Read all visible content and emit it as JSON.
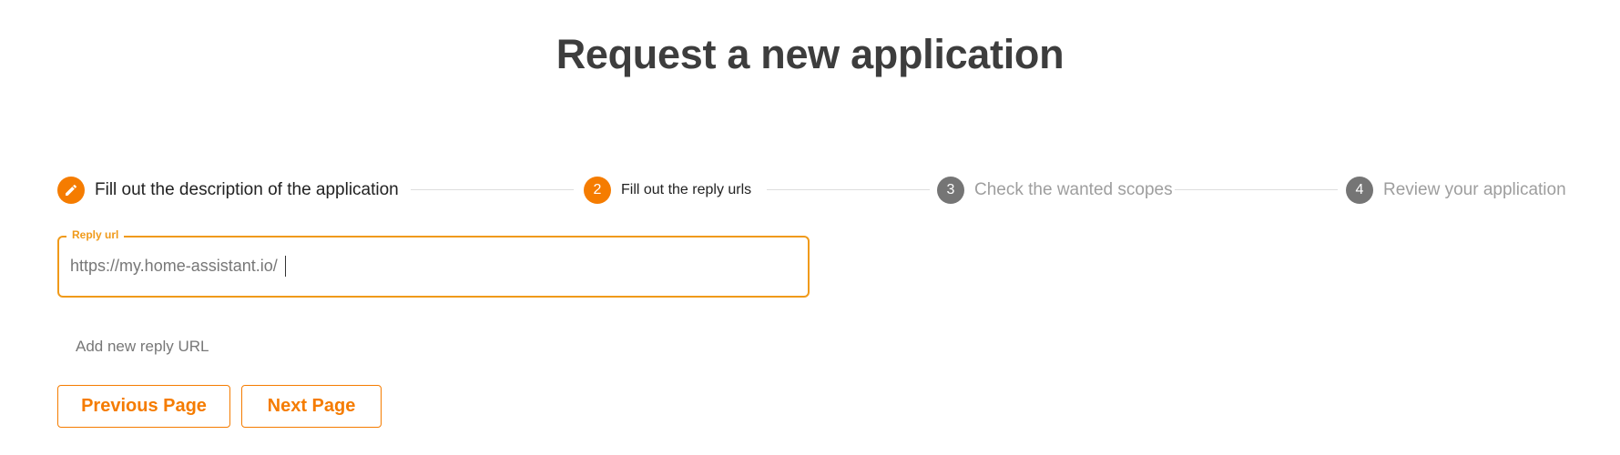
{
  "page": {
    "title": "Request a new application"
  },
  "stepper": {
    "steps": [
      {
        "number": "",
        "label": "Fill out the description of the application",
        "state": "done",
        "icon": "pencil-icon"
      },
      {
        "number": "2",
        "label": "Fill out the reply urls",
        "state": "current"
      },
      {
        "number": "3",
        "label": "Check the wanted scopes",
        "state": "upcoming"
      },
      {
        "number": "4",
        "label": "Review your application",
        "state": "upcoming"
      }
    ]
  },
  "reply_url": {
    "label": "Reply url",
    "value": "https://my.home-assistant.io/"
  },
  "add_link": {
    "label": "Add new reply URL"
  },
  "buttons": {
    "previous": "Previous Page",
    "next": "Next Page"
  },
  "colors": {
    "accent": "#f57c00",
    "field_outline": "#f09a1a",
    "inactive_step": "#757575"
  }
}
